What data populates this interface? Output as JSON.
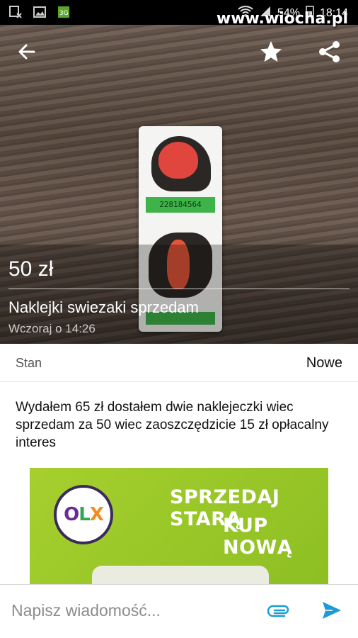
{
  "watermark": "www.wiocha.pl",
  "status": {
    "battery": "54%",
    "time": "18:14"
  },
  "listing": {
    "price": "50 zł",
    "title": "Naklejki swiezaki sprzedam",
    "date": "Wczoraj o 14:26",
    "sticker_code": "228184564"
  },
  "details": {
    "state_label": "Stan",
    "state_value": "Nowe"
  },
  "description": "Wydałem 65 zł dostałem dwie naklejeczki wiec sprzedam za 50 wiec zaoszczędzicie 15 zł opłacalny interes",
  "banner": {
    "logo": {
      "o": "O",
      "l": "L",
      "x": "X"
    },
    "line1": "SPRZEDAJ STARĄ",
    "line2": "KUP NOWĄ"
  },
  "message": {
    "placeholder": "Napisz wiadomość..."
  },
  "colors": {
    "accent": "#1e9ad6",
    "banner": "#9cc928"
  },
  "icons": [
    "back-arrow-icon",
    "star-icon",
    "share-icon",
    "attach-icon",
    "send-icon"
  ]
}
